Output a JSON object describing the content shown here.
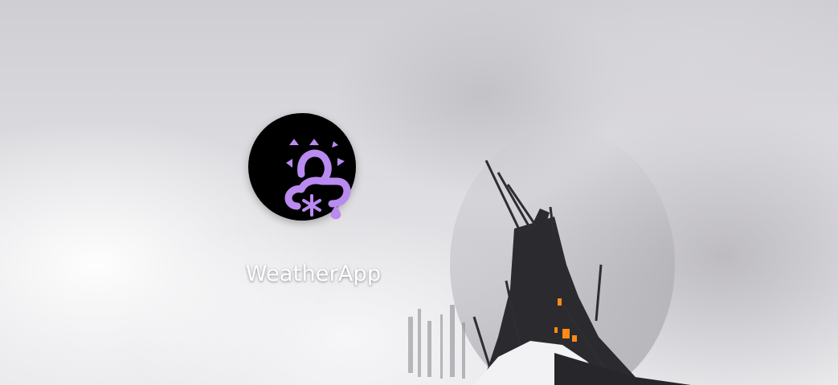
{
  "home_screen": {
    "apps": [
      {
        "label": "WeatherApp",
        "icon": "weather-snow-rain-sun-icon",
        "icon_background": "#000000",
        "icon_color": "#b98af0"
      }
    ]
  }
}
